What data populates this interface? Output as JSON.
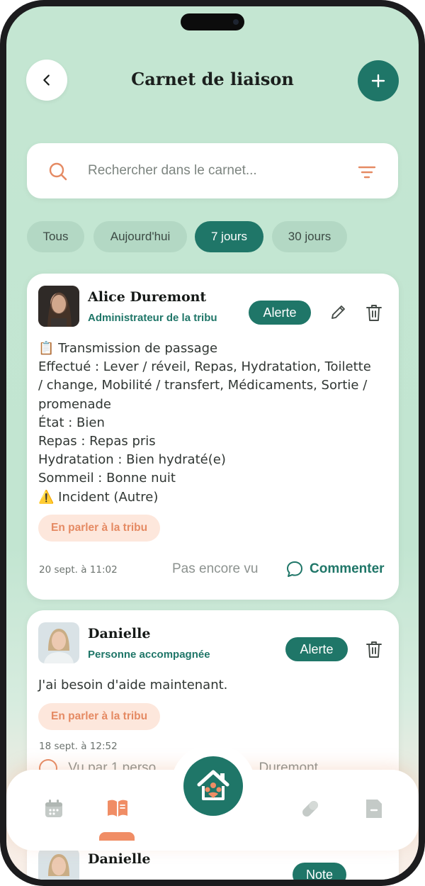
{
  "header": {
    "title": "Carnet de liaison",
    "back_icon": "chevron-left-icon",
    "add_icon": "plus-icon"
  },
  "search": {
    "placeholder": "Rechercher dans le carnet...",
    "search_icon": "search-icon",
    "filter_icon": "filter-icon"
  },
  "filters": {
    "chips": [
      "Tous",
      "Aujourd'hui",
      "7 jours",
      "30 jours"
    ],
    "selected": "7 jours"
  },
  "entries": [
    {
      "author": "Alice Duremont",
      "role": "Administrateur de la tribu",
      "badge": "Alerte",
      "lines": [
        "📋 Transmission de passage",
        "Effectué : Lever / réveil, Repas, Hydratation, Toilette",
        "/ change, Mobilité / transfert, Médicaments, Sortie /",
        "promenade",
        "État : Bien",
        "Repas : Repas pris",
        "Hydratation : Bien hydraté(e)",
        "Sommeil : Bonne nuit",
        "⚠️ Incident (Autre)"
      ],
      "action": "En parler à la tribu",
      "timestamp": "20 sept. à 11:02",
      "status": "Pas encore vu",
      "comment_label": "Commenter"
    },
    {
      "author": "Danielle",
      "role": "Personne accompagnée",
      "badge": "Alerte",
      "lines": [
        "J'ai besoin d'aide maintenant."
      ],
      "action": "En parler à la tribu",
      "timestamp": "18 sept. à 12:52",
      "status_prefix": "Vu par 1 perso",
      "status_suffix": "Duremont"
    },
    {
      "author": "Danielle",
      "badge_partial": "Note"
    }
  ],
  "bottom_nav": {
    "items": [
      "calendar-icon",
      "book-open-icon",
      "home-family-icon",
      "pill-icon",
      "folder-icon"
    ],
    "active": "book-open-icon"
  },
  "colors": {
    "primary": "#1f7668",
    "accent": "#f08d65",
    "background": "#c4e6d2"
  }
}
